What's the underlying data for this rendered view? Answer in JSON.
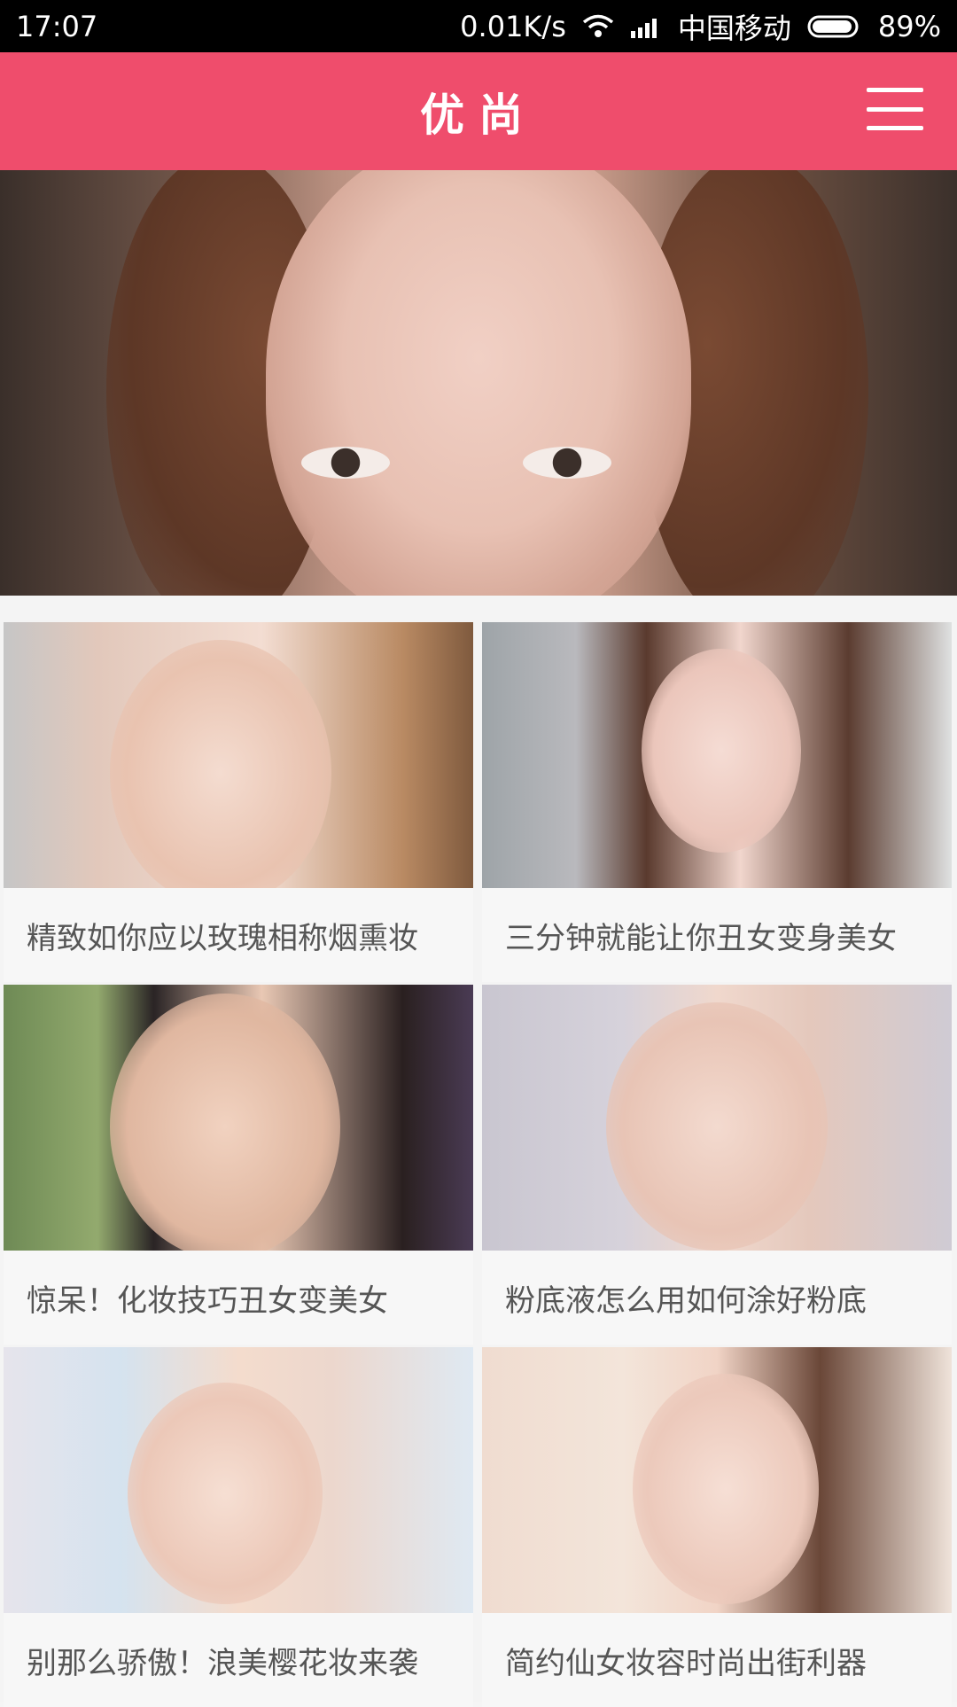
{
  "status_bar": {
    "time": "17:07",
    "speed": "0.01K/s",
    "carrier": "中国移动",
    "battery": "89%"
  },
  "header": {
    "title": "优尚"
  },
  "banner": {
    "page_count": 2,
    "active_page": 1
  },
  "cards": [
    {
      "title": "精致如你应以玫瑰相称烟熏妆"
    },
    {
      "title": "三分钟就能让你丑女变身美女"
    },
    {
      "title": "惊呆！化妆技巧丑女变美女"
    },
    {
      "title": "粉底液怎么用如何涂好粉底"
    },
    {
      "title": "别那么骄傲！浪美樱花妆来袭"
    },
    {
      "title": "简约仙女妆容时尚出街利器"
    }
  ],
  "colors": {
    "header_bg": "#ef4d6c",
    "status_bar_bg": "#000000"
  },
  "icons": {
    "menu": "hamburger-menu-icon",
    "wifi": "wifi-icon",
    "signal": "signal-icon",
    "battery": "battery-icon"
  }
}
